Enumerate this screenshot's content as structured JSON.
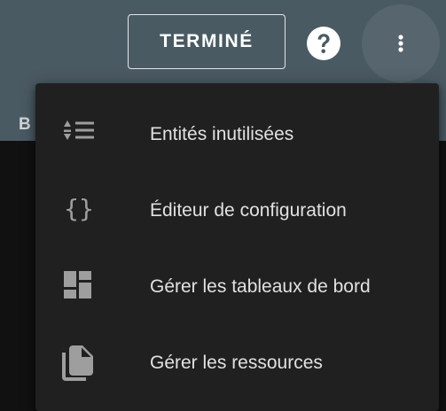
{
  "header": {
    "done_label": "TERMINÉ",
    "tab_peek": "B"
  },
  "menu": {
    "items": [
      {
        "label": "Entités inutilisées",
        "icon": "format-list-numbered-icon"
      },
      {
        "label": "Éditeur de configuration",
        "icon": "code-braces-icon"
      },
      {
        "label": "Gérer les tableaux de bord",
        "icon": "view-dashboard-icon"
      },
      {
        "label": "Gérer les ressources",
        "icon": "file-multiple-icon"
      }
    ]
  },
  "colors": {
    "header_bg": "#4a5a63",
    "menu_bg": "#202020",
    "menu_text": "#e1e1e1",
    "icon": "#9e9e9e",
    "page_bg": "#111111"
  }
}
